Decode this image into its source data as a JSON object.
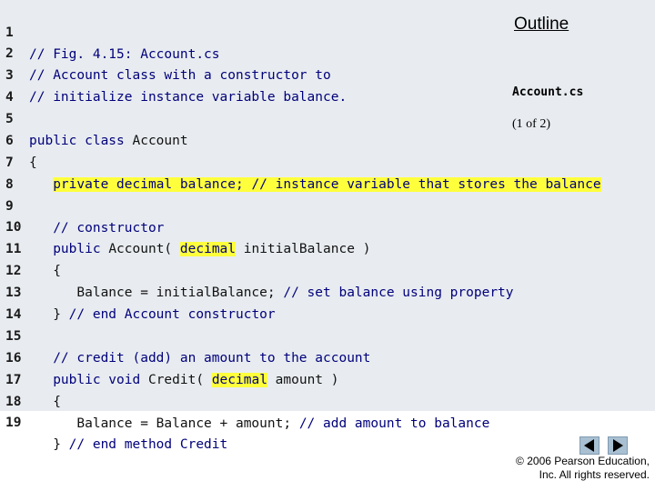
{
  "sidebar": {
    "title": "Outline",
    "file": "Account.cs",
    "page": "(1 of 2)"
  },
  "code_lines": [
    {
      "n": "1",
      "text": "// Fig. 4.15: Account.cs"
    },
    {
      "n": "2",
      "text": "// Account class with a constructor to"
    },
    {
      "n": "3",
      "text": "// initialize instance variable balance."
    },
    {
      "n": "4",
      "text": ""
    },
    {
      "n": "5",
      "text": "public class Account"
    },
    {
      "n": "6",
      "text": "{"
    },
    {
      "n": "7",
      "text": "   private decimal balance; // instance variable that stores the balance"
    },
    {
      "n": "8",
      "text": ""
    },
    {
      "n": "9",
      "text": "   // constructor"
    },
    {
      "n": "10",
      "text": "   public Account( decimal initialBalance )"
    },
    {
      "n": "11",
      "text": "   {"
    },
    {
      "n": "12",
      "text": "      Balance = initialBalance; // set balance using property"
    },
    {
      "n": "13",
      "text": "   } // end Account constructor"
    },
    {
      "n": "14",
      "text": ""
    },
    {
      "n": "15",
      "text": "   // credit (add) an amount to the account"
    },
    {
      "n": "16",
      "text": "   public void Credit( decimal amount )"
    },
    {
      "n": "17",
      "text": "   {"
    },
    {
      "n": "18",
      "text": "      Balance = Balance + amount; // add amount to balance"
    },
    {
      "n": "19",
      "text": "   } // end method Credit"
    }
  ],
  "tokens": {
    "l5_kw": "public class",
    "l5_rest": " Account",
    "l7_indent": "   ",
    "l7_hl": "private decimal balance; // instance variable that stores the balance",
    "l10_kw": "public",
    "l10_a": " Account( ",
    "l10_hl": "decimal",
    "l10_b": " initialBalance )",
    "l12_code": "      Balance = initialBalance; ",
    "l12_cm": "// set balance using property",
    "l13_code": "   } ",
    "l13_cm": "// end Account constructor",
    "l16_kw": "public void",
    "l16_a": " Credit( ",
    "l16_hl": "decimal",
    "l16_b": " amount )",
    "l18_code": "      Balance = Balance + amount; ",
    "l18_cm": "// add amount to balance",
    "l19_code": "   } ",
    "l19_cm": "// end method Credit"
  },
  "nav": {
    "prev_icon": "triangle-left-icon",
    "next_icon": "triangle-right-icon"
  },
  "footer": {
    "copyright_line1": "© 2006 Pearson Education,",
    "copyright_line2": "Inc.  All rights reserved."
  },
  "colors": {
    "panel_bg": "#e8ecf0",
    "keyword": "#00007a",
    "highlight": "#ffff3c",
    "nav_button": "#a9c0d2",
    "nav_arrow": "#000000"
  }
}
